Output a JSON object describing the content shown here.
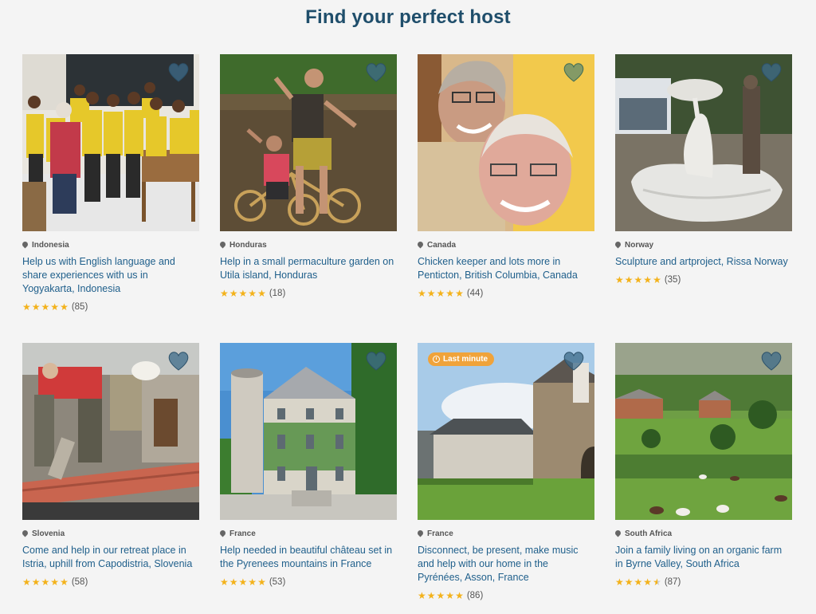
{
  "header": {
    "title": "Find your perfect host"
  },
  "badges": {
    "last_minute": "Last minute"
  },
  "colors": {
    "accent": "#1f4e6b",
    "link": "#1f5f8b",
    "star": "#f3b21b",
    "badge": "#f0a33a"
  },
  "listings": [
    {
      "country": "Indonesia",
      "title": "Help us with English language and share experiences with us in Yogyakarta, Indonesia",
      "rating": 5,
      "reviews": "(85)"
    },
    {
      "country": "Honduras",
      "title": "Help in a small permaculture garden on Utila island, Honduras",
      "rating": 5,
      "reviews": "(18)"
    },
    {
      "country": "Canada",
      "title": "Chicken keeper and lots more in Penticton, British Columbia, Canada",
      "rating": 5,
      "reviews": "(44)"
    },
    {
      "country": "Norway",
      "title": "Sculpture and artproject, Rissa Norway",
      "rating": 5,
      "reviews": "(35)"
    },
    {
      "country": "Slovenia",
      "title": "Come and help in our retreat place in Istria, uphill from Capodistria, Slovenia",
      "rating": 5,
      "reviews": "(58)"
    },
    {
      "country": "France",
      "title": "Help needed in beautiful château set in the Pyrenees mountains in France",
      "rating": 5,
      "reviews": "(53)"
    },
    {
      "country": "France",
      "title": "Disconnect, be present, make music and help with our home in the Pyrénées, Asson, France",
      "rating": 5,
      "reviews": "(86)"
    },
    {
      "country": "South Africa",
      "title": "Join a family living on an organic farm in Byrne Valley, South Africa",
      "rating": 4.5,
      "reviews": "(87)"
    }
  ]
}
